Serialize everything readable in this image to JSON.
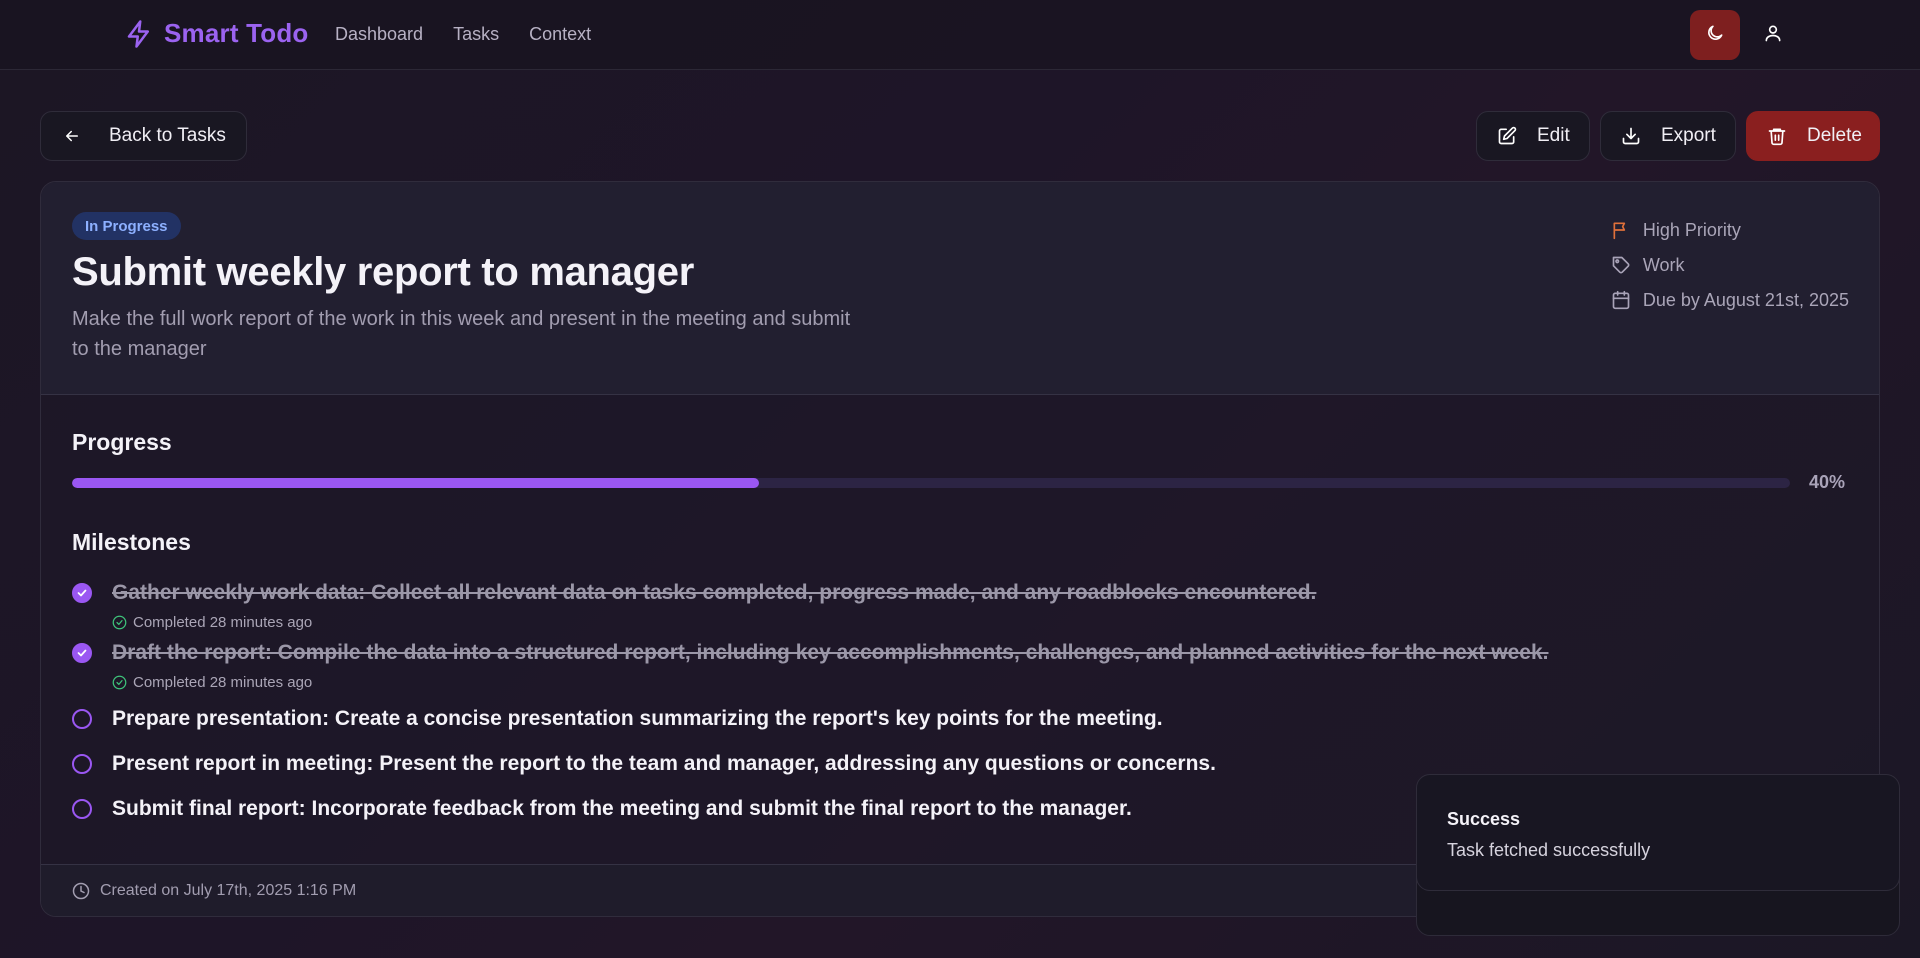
{
  "header": {
    "brand": "Smart Todo",
    "nav": [
      "Dashboard",
      "Tasks",
      "Context"
    ]
  },
  "actions": {
    "back_label": "Back to Tasks",
    "edit_label": "Edit",
    "export_label": "Export",
    "delete_label": "Delete"
  },
  "task": {
    "status": "In Progress",
    "title": "Submit weekly report to manager",
    "description": "Make the full work report of the work in this week and present in the meeting and submit to the manager",
    "priority": "High Priority",
    "category": "Work",
    "due": "Due by August 21st, 2025",
    "created": "Created on July 17th, 2025 1:16 PM"
  },
  "progress": {
    "title": "Progress",
    "percent_label": "40%",
    "percent": 40
  },
  "milestones": {
    "title": "Milestones",
    "items": [
      {
        "text": "Gather weekly work data: Collect all relevant data on tasks completed, progress made, and any roadblocks encountered.",
        "done": true,
        "completed_label": "Completed 28 minutes ago"
      },
      {
        "text": "Draft the report: Compile the data into a structured report, including key accomplishments, challenges, and planned activities for the next week.",
        "done": true,
        "completed_label": "Completed 28 minutes ago"
      },
      {
        "text": "Prepare presentation: Create a concise presentation summarizing the report's key points for the meeting.",
        "done": false
      },
      {
        "text": "Present report in meeting: Present the report to the team and manager, addressing any questions or concerns.",
        "done": false
      },
      {
        "text": "Submit final report: Incorporate feedback from the meeting and submit the final report to the manager.",
        "done": false
      }
    ]
  },
  "toast": {
    "title": "Success",
    "message": "Task fetched successfully"
  },
  "colors": {
    "accent": "#9a57f2",
    "danger": "#8a1f1f",
    "priority": "#e0703a",
    "success": "#3ec27a"
  },
  "icons": [
    "bolt-icon",
    "moon-icon",
    "user-icon",
    "arrow-left-icon",
    "edit-icon",
    "download-icon",
    "trash-icon",
    "flag-icon",
    "tag-icon",
    "calendar-icon",
    "check-icon",
    "check-circle-icon",
    "clock-icon"
  ]
}
